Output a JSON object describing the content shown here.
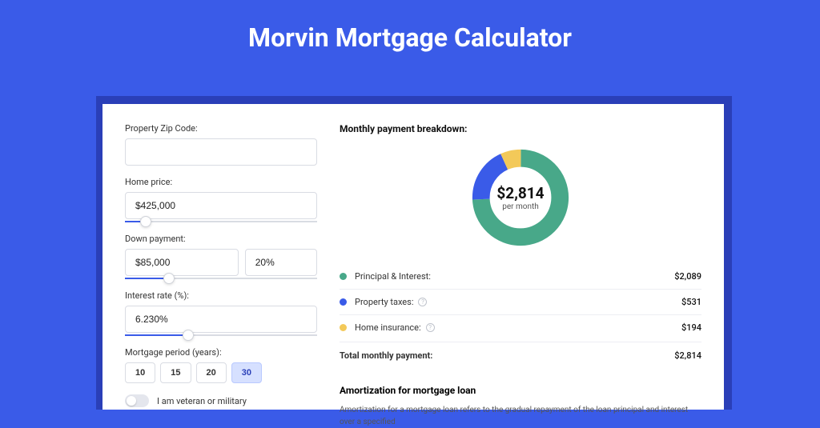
{
  "title": "Morvin Mortgage Calculator",
  "form": {
    "zip_label": "Property Zip Code:",
    "zip_value": "",
    "home_price_label": "Home price:",
    "home_price_value": "$425,000",
    "down_payment_label": "Down payment:",
    "down_payment_value": "$85,000",
    "down_payment_pct": "20%",
    "interest_label": "Interest rate (%):",
    "interest_value": "6.230%",
    "period_label": "Mortgage period (years):",
    "periods": [
      "10",
      "15",
      "20",
      "30"
    ],
    "period_active": "30",
    "veteran_label": "I am veteran or military",
    "veteran_on": false
  },
  "sliders": {
    "home_price_pct": 8,
    "down_payment_pct": 20,
    "interest_pct": 30
  },
  "breakdown": {
    "title": "Monthly payment breakdown:",
    "amount": "$2,814",
    "sub": "per month",
    "items": [
      {
        "label": "Principal & Interest:",
        "value": "$2,089",
        "color": "#48a889",
        "info": false
      },
      {
        "label": "Property taxes:",
        "value": "$531",
        "color": "#3a5be8",
        "info": true
      },
      {
        "label": "Home insurance:",
        "value": "$194",
        "color": "#f3c959",
        "info": true
      }
    ],
    "total_label": "Total monthly payment:",
    "total_value": "$2,814"
  },
  "chart_data": {
    "type": "pie",
    "title": "Monthly payment breakdown",
    "series": [
      {
        "name": "Principal & Interest",
        "value": 2089,
        "color": "#48a889"
      },
      {
        "name": "Property taxes",
        "value": 531,
        "color": "#3a5be8"
      },
      {
        "name": "Home insurance",
        "value": 194,
        "color": "#f3c959"
      }
    ],
    "center_label": "$2,814",
    "center_sub": "per month"
  },
  "amort": {
    "title": "Amortization for mortgage loan",
    "text": "Amortization for a mortgage loan refers to the gradual repayment of the loan principal and interest over a specified"
  }
}
